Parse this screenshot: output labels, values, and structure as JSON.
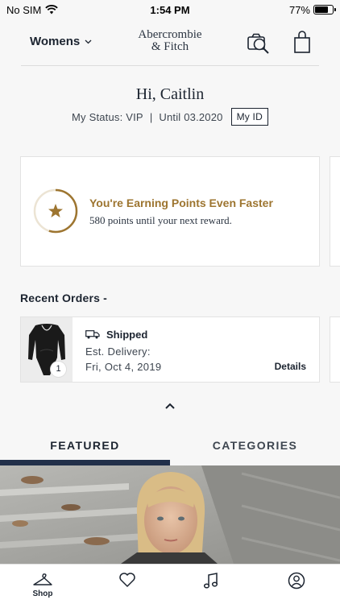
{
  "status_bar": {
    "carrier": "No SIM",
    "time": "1:54 PM",
    "battery": "77%",
    "battery_level": 0.77
  },
  "header": {
    "gender": "Womens",
    "logo_line1": "Abercrombie",
    "logo_line2": "& Fitch",
    "icons": [
      "chevron-down-icon",
      "camera-search-icon",
      "shopping-bag-icon"
    ]
  },
  "profile": {
    "greeting": "Hi, Caitlin",
    "status": "My Status: VIP",
    "separator": "|",
    "until": "Until 03.2020",
    "my_id_button": "My ID"
  },
  "points": {
    "title": "You're Earning Points Even Faster",
    "subtitle": "580 points until your next reward.",
    "progress": 0.55,
    "accent": "#9d7530"
  },
  "orders": {
    "title": "Recent Orders -",
    "items": [
      {
        "quantity": "1",
        "status": "Shipped",
        "delivery_label": "Est. Delivery:",
        "delivery_date": "Fri, Oct 4, 2019",
        "details_label": "Details"
      }
    ]
  },
  "tabs": {
    "featured": "FEATURED",
    "categories": "CATEGORIES",
    "active": "FEATURED",
    "indicator_color": "#22304a"
  },
  "bottom_nav": {
    "items": [
      {
        "icon": "hanger-icon",
        "label": "Shop"
      },
      {
        "icon": "heart-icon",
        "label": ""
      },
      {
        "icon": "music-note-icon",
        "label": ""
      },
      {
        "icon": "profile-icon",
        "label": ""
      }
    ]
  }
}
